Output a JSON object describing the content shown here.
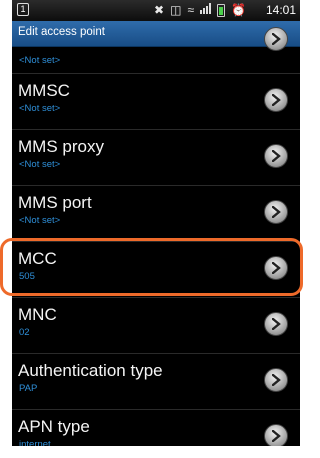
{
  "status_bar": {
    "left_badge": "1",
    "time": "14:01"
  },
  "title_bar": {
    "title": "Edit access point"
  },
  "list": {
    "items": [
      {
        "title": "",
        "value": "<Not set>"
      },
      {
        "title": "MMSC",
        "value": "<Not set>"
      },
      {
        "title": "MMS proxy",
        "value": "<Not set>"
      },
      {
        "title": "MMS port",
        "value": "<Not set>"
      },
      {
        "title": "MCC",
        "value": "505"
      },
      {
        "title": "MNC",
        "value": "02"
      },
      {
        "title": "Authentication type",
        "value": "PAP"
      },
      {
        "title": "APN type",
        "value": "internet"
      }
    ]
  },
  "colors": {
    "title_bar": "#1f5c99",
    "value_text": "#2f8fd8",
    "highlight": "#ee6a2a"
  }
}
